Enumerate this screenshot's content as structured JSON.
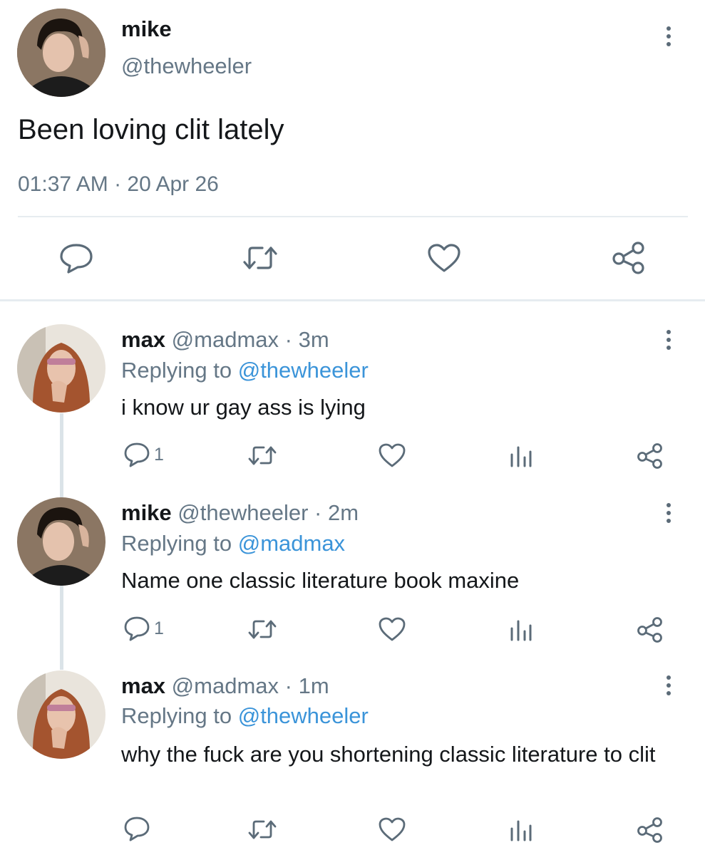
{
  "main_tweet": {
    "display_name": "mike",
    "handle": "@thewheeler",
    "text": "Been loving clit lately",
    "timestamp": "01:37 AM · 20 Apr 26",
    "actions": [
      "reply-icon",
      "retweet-icon",
      "like-icon",
      "share-icon"
    ]
  },
  "replies": [
    {
      "display_name": "max",
      "handle": "@madmax",
      "time": "· 3m",
      "replying_label": "Replying to",
      "replying_to": "@thewheeler",
      "text": "i know ur gay ass is lying",
      "reply_count": "1"
    },
    {
      "display_name": "mike",
      "handle": "@thewheeler",
      "time": "· 2m",
      "replying_label": "Replying to",
      "replying_to": "@madmax",
      "text": "Name one classic literature book maxine",
      "reply_count": "1"
    },
    {
      "display_name": "max",
      "handle": "@madmax",
      "time": "· 1m",
      "replying_label": "Replying to",
      "replying_to": "@thewheeler",
      "text": "why the fuck are you shortening classic literature to clit",
      "reply_count": ""
    }
  ],
  "colors": {
    "text": "#14171a",
    "muted": "#657786",
    "link": "#3b94d9",
    "divider": "#e6ecf0",
    "icon": "#5b6b78"
  }
}
